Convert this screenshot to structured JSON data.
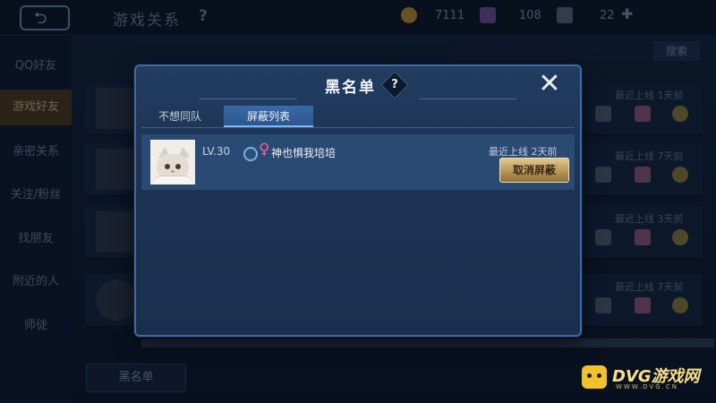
{
  "topbar": {
    "back_icon": "back-arrow-icon",
    "title": "游戏关系",
    "help": "?",
    "gold": "7111",
    "diamond": "108",
    "coupon": "22"
  },
  "sidebar": {
    "items": [
      {
        "label": "QQ好友"
      },
      {
        "label": "游戏好友"
      },
      {
        "label": "亲密关系"
      },
      {
        "label": "关注/粉丝"
      },
      {
        "label": "找朋友"
      },
      {
        "label": "附近的人"
      },
      {
        "label": "师徒"
      }
    ]
  },
  "friends_bg": {
    "search_button": "搜索",
    "rows": [
      {
        "last_online": "最近上线  1天前"
      },
      {
        "last_online": "最近上线  7天前"
      },
      {
        "last_online": "最近上线  3天前"
      },
      {
        "last_online": "最近上线  7天前"
      }
    ],
    "blacklist_button": "黑名单"
  },
  "modal": {
    "title": "黑名单",
    "help": "?",
    "close_icon": "close-x-icon",
    "tabs": [
      {
        "label": "不想同队",
        "active": false
      },
      {
        "label": "屏蔽列表",
        "active": true
      }
    ],
    "blocked": [
      {
        "level": "LV.30",
        "nickname": "神也惧我培培",
        "gender": "female",
        "last_online": "最近上线  2天前",
        "unblock_label": "取消屏蔽"
      }
    ]
  },
  "watermark": {
    "text": "DVG游戏网",
    "sub": "WWW.DVG.CN"
  },
  "colors": {
    "accent_tab": "#3a6aa6",
    "button_gold": "#c9a96a",
    "female": "#ff5fa0"
  }
}
